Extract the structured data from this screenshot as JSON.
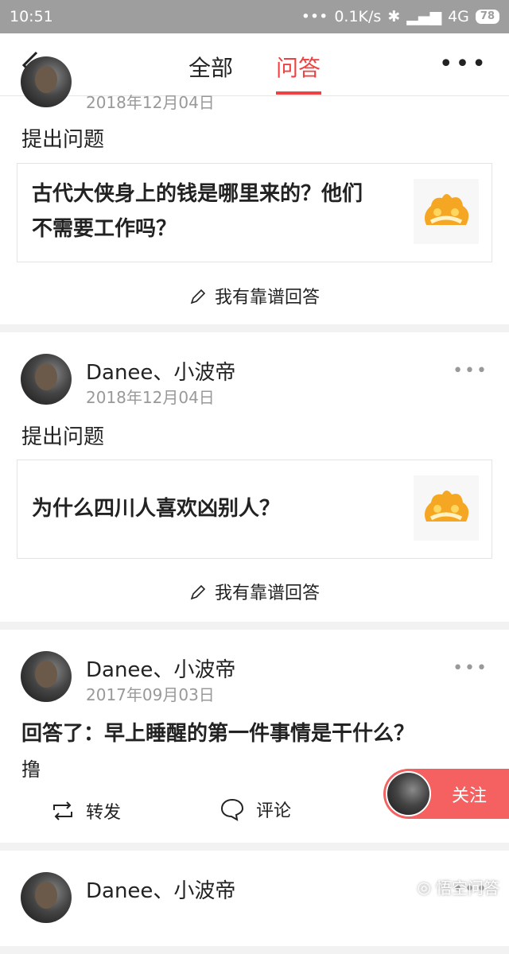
{
  "status": {
    "time": "10:51",
    "net_speed": "0.1K/s",
    "signal": "4G",
    "battery": "78"
  },
  "nav": {
    "tab_all": "全部",
    "tab_qa": "问答"
  },
  "cards": [
    {
      "date": "2018年12月04日",
      "action": "提出问题",
      "question": "古代大侠身上的钱是哪里来的？他们不需要工作吗？",
      "answer_link": "我有靠谱回答"
    },
    {
      "user": "Danee、小波帝",
      "date": "2018年12月04日",
      "action": "提出问题",
      "question": "为什么四川人喜欢凶别人？",
      "answer_link": "我有靠谱回答"
    },
    {
      "user": "Danee、小波帝",
      "date": "2017年09月03日",
      "answer_title": "回答了：早上睡醒的第一件事情是干什么？",
      "answer_body": "撸",
      "repost": "转发",
      "comment": "评论"
    },
    {
      "user": "Danee、小波帝"
    }
  ],
  "follow_label": "关注",
  "watermark": "悟空问答",
  "colors": {
    "accent": "#f04142",
    "follow_bg": "#f56161",
    "meta": "#999999"
  }
}
